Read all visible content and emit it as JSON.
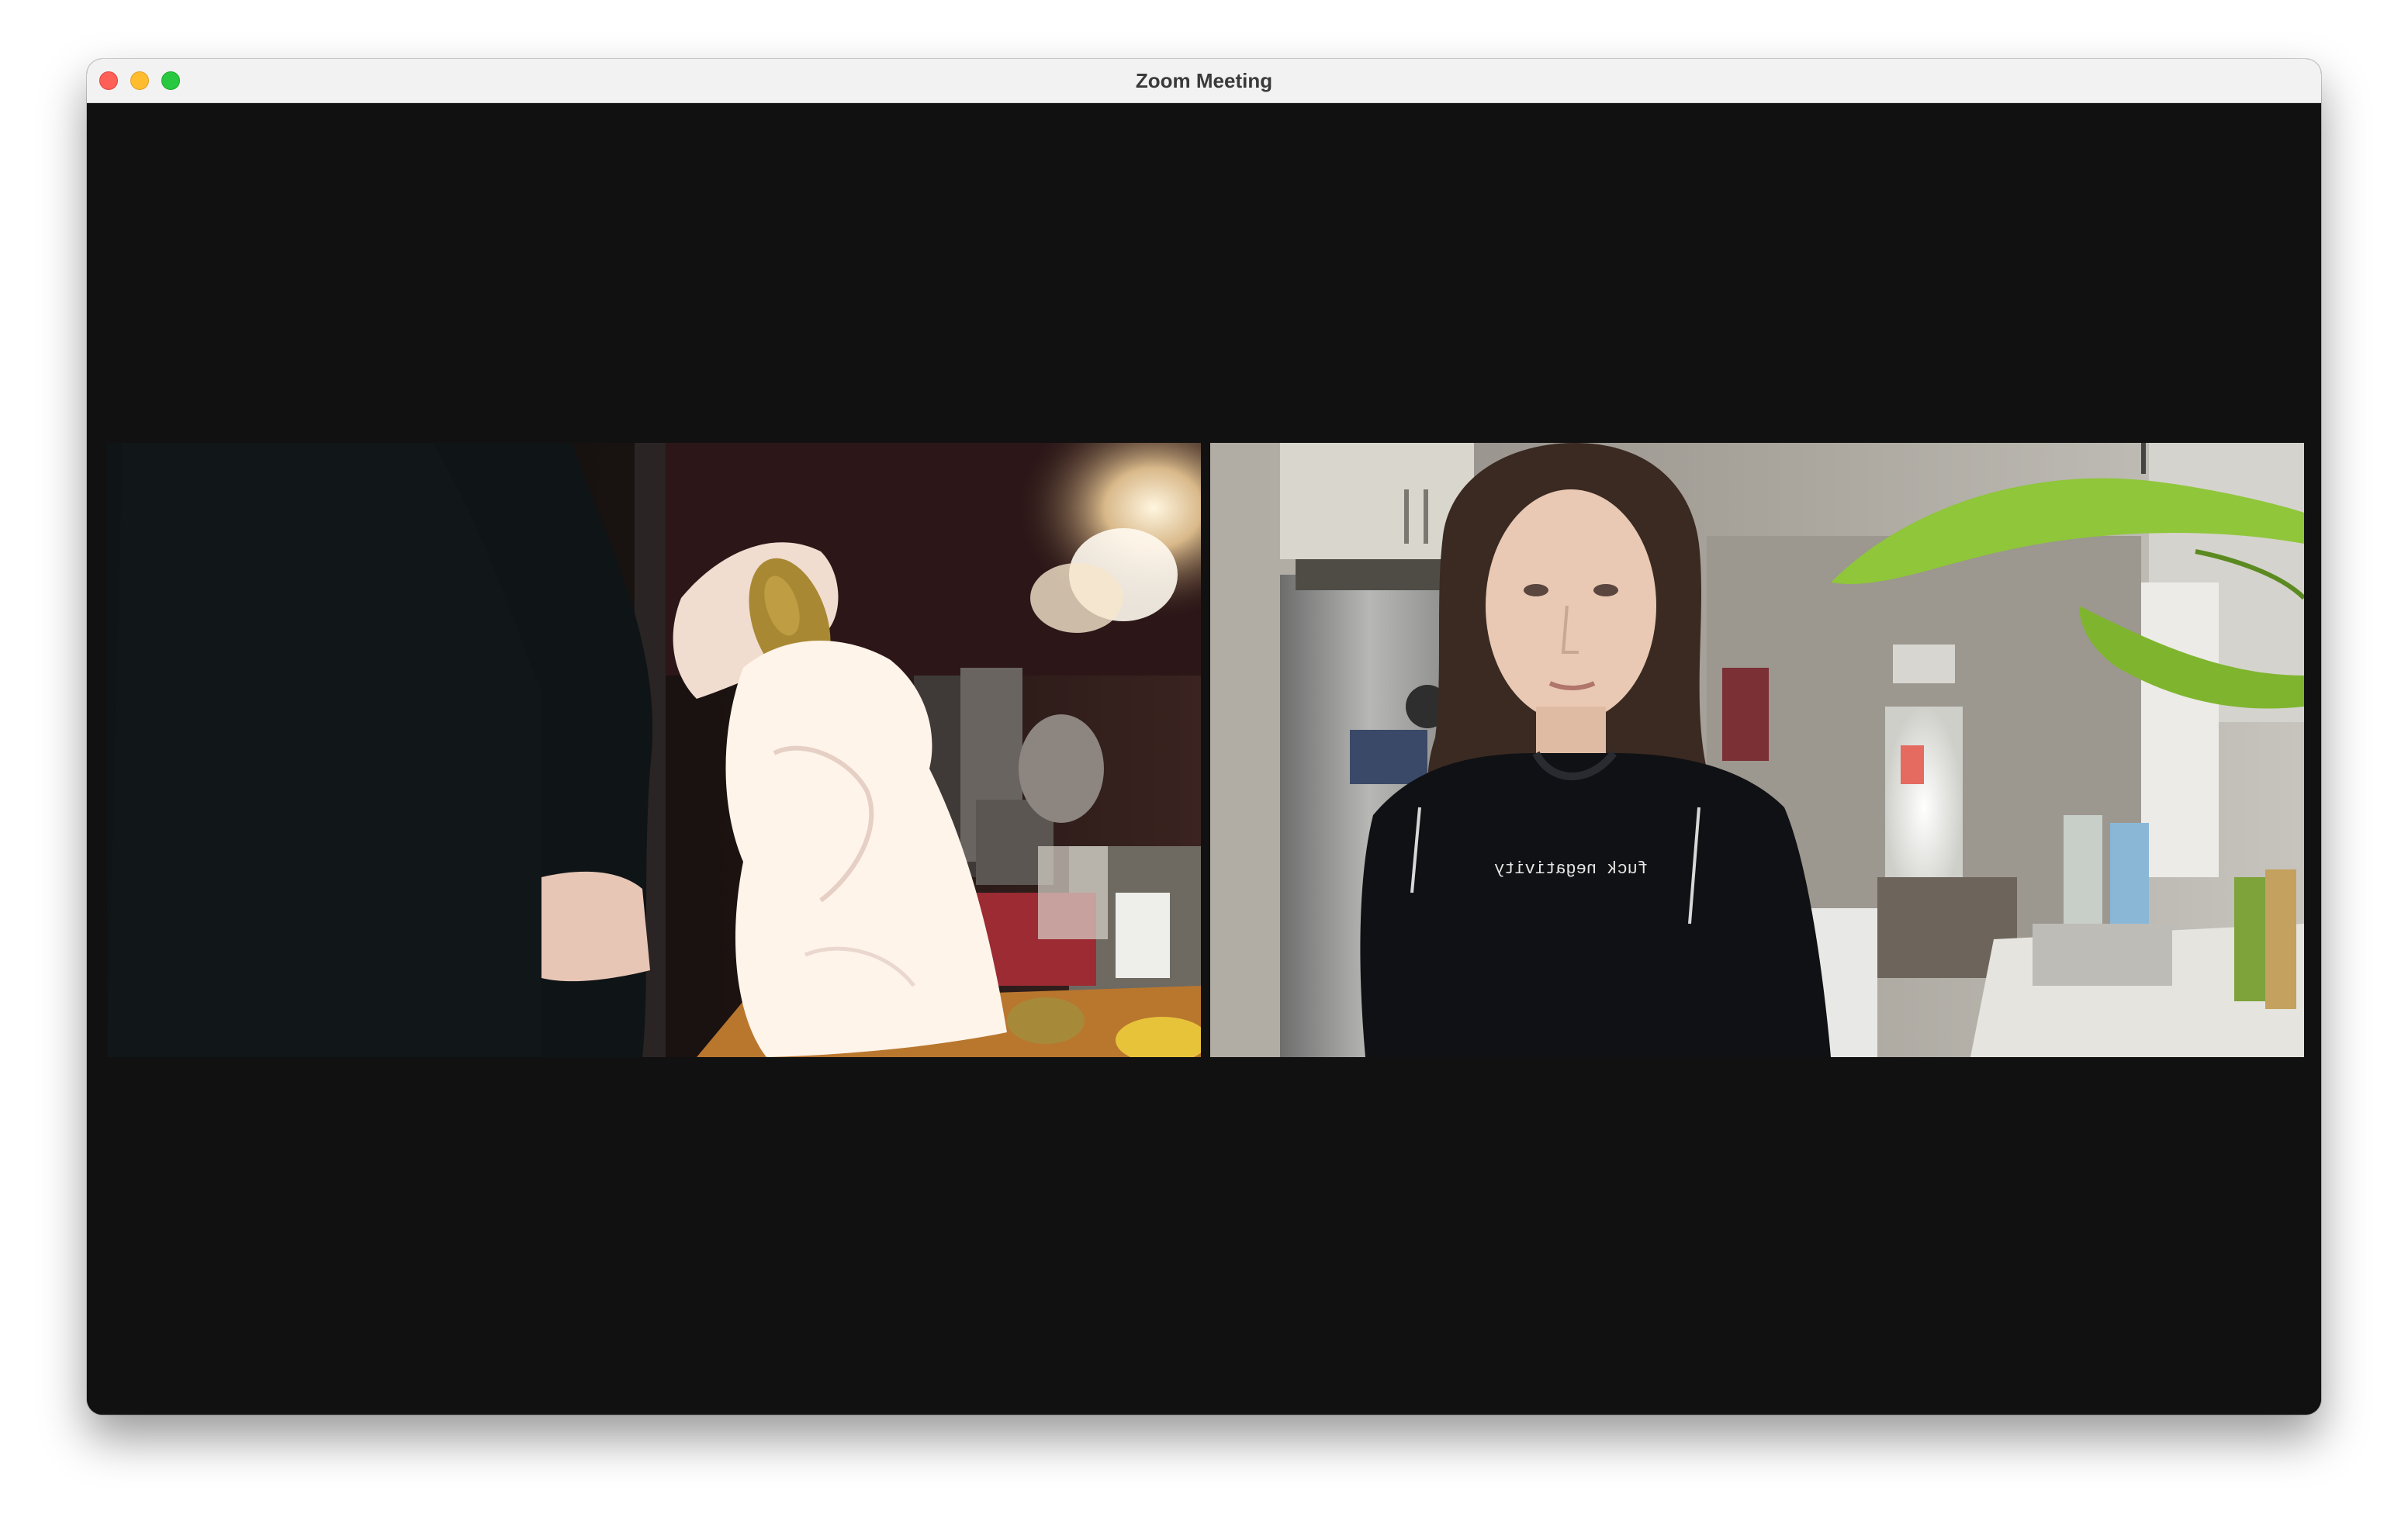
{
  "window": {
    "title": "Zoom Meeting",
    "controls": [
      "close",
      "minimize",
      "zoom"
    ]
  },
  "participants": [
    {
      "tile": "left",
      "video": "kitchen-scene-hands-holding-potato-and-paper-towel"
    },
    {
      "tile": "right",
      "video": "young-woman-in-kitchen",
      "shirt_text": "fuck negativity"
    }
  ],
  "colors": {
    "stage_background": "#111111",
    "titlebar_background": "#f3f2f3",
    "close": "#fe5f57",
    "minimize": "#febc2e",
    "zoom": "#28c840"
  }
}
